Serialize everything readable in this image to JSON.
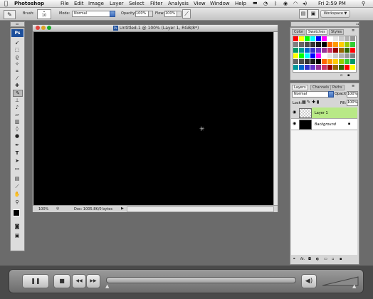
{
  "menubar": {
    "apple_icon": "apple-icon",
    "app_name": "Photoshop",
    "items": [
      "File",
      "Edit",
      "Image",
      "Layer",
      "Select",
      "Filter",
      "Analysis",
      "View",
      "Window",
      "Help"
    ],
    "clock": "Fri 2:59 PM"
  },
  "options": {
    "brush_label": "Brush:",
    "brush_size": "10",
    "mode_label": "Mode:",
    "mode_value": "Normal",
    "opacity_label": "Opacity:",
    "opacity_value": "100%",
    "flow_label": "Flow:",
    "flow_value": "100%",
    "workspace_label": "Workspace ▼"
  },
  "toolbox": {
    "logo": "Ps"
  },
  "document": {
    "title": "Untitled-1 @ 100% (Layer 1, RGB/8*)",
    "zoom": "100%",
    "doc_info": "Doc: 1005.8K/0 bytes",
    "canvas_color": "#000000"
  },
  "swatches_panel": {
    "tabs": [
      "Color",
      "Swatches",
      "Styles"
    ],
    "active_tab": "Swatches",
    "swatch_colors": [
      "#ff0000",
      "#ffff00",
      "#00ff00",
      "#00ffff",
      "#0000ff",
      "#ff00ff",
      "#ffffff",
      "#e6e6e6",
      "#cccccc",
      "#b3b3b3",
      "#999999",
      "#808080",
      "#666666",
      "#4d4d4d",
      "#333333",
      "#1a1a1a",
      "#000000",
      "#ff6600",
      "#ff9900",
      "#ffcc00",
      "#99cc00",
      "#33cc33",
      "#009966",
      "#009999",
      "#0066cc",
      "#3333cc",
      "#6633cc",
      "#993399",
      "#cc3366",
      "#990000",
      "#996600",
      "#336600"
    ]
  },
  "layers_panel": {
    "tabs": [
      "Layers",
      "Channels",
      "Paths"
    ],
    "active_tab": "Layers",
    "blend_mode": "Normal",
    "opacity_label": "Opacity:",
    "opacity_value": "100%",
    "lock_label": "Lock:",
    "fill_label": "Fill:",
    "fill_value": "100%",
    "layers": [
      {
        "name": "Layer 1",
        "selected": true
      },
      {
        "name": "Background",
        "selected": false,
        "locked": true
      }
    ],
    "footer_glyph": "fx."
  },
  "transport": {
    "pause_label": "❚❚",
    "stop_label": "■",
    "rewind_label": "◀◀",
    "forward_label": "▶▶",
    "volume_icon": "speaker-icon"
  },
  "colors": {
    "layer_selected": "#b8e986",
    "menubar": "#e8e8e8",
    "workspace": "#6b6b6b"
  }
}
